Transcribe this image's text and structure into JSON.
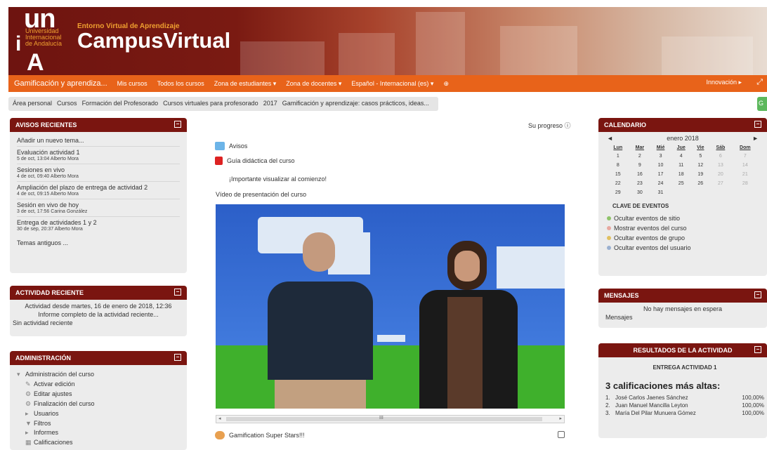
{
  "header": {
    "logo_un": "un",
    "logo_i": "i",
    "logo_sub": [
      "Universidad",
      "Internacional",
      "de Andalucía"
    ],
    "logo_a": "A",
    "entorno": "Entorno Virtual de Aprendizaje",
    "campus": "CampusVirtual"
  },
  "navbar": {
    "brand": "Gamificación y aprendiza...",
    "items": [
      "Mis cursos",
      "Todos los cursos",
      "Zona de estudiantes ▾",
      "Zona de docentes ▾",
      "Español - Internacional (es) ▾",
      "⊕"
    ],
    "user": "Innovación ▸",
    "expand": "⤢"
  },
  "breadcrumb": [
    "Área personal",
    "Cursos",
    "Formación del Profesorado",
    "Cursos virtuales para profesorado",
    "2017",
    "Gamificación y aprendizaje: casos prácticos, ideas..."
  ],
  "green_button": "G",
  "avisos": {
    "title": "AVISOS RECIENTES",
    "add": "Añadir un nuevo tema...",
    "items": [
      {
        "title": "Evaluación actividad 1",
        "meta": "5 de oct, 13:04  Alberto Mora"
      },
      {
        "title": "Sesiones en vivo",
        "meta": "4 de oct, 09:40  Alberto Mora"
      },
      {
        "title": "Ampliación del plazo de entrega de actividad 2",
        "meta": "4 de oct, 09:15  Alberto Mora"
      },
      {
        "title": "Sesión en vivo de hoy",
        "meta": "3 de oct, 17:56  Carina González"
      },
      {
        "title": "Entrega de actividades 1 y 2",
        "meta": "30 de sep, 20:37  Alberto Mora"
      }
    ],
    "old": "Temas antiguos ..."
  },
  "actividad": {
    "title": "ACTIVIDAD RECIENTE",
    "since": "Actividad desde martes, 16 de enero de 2018, 12:36",
    "full": "Informe completo de la actividad reciente...",
    "none": "Sin actividad reciente"
  },
  "admin": {
    "title": "ADMINISTRACIÓN",
    "items": [
      {
        "icon": "▾",
        "label": "Administración del curso"
      },
      {
        "icon": "✎",
        "label": "Activar edición"
      },
      {
        "icon": "⚙",
        "label": "Editar ajustes"
      },
      {
        "icon": "⚙",
        "label": "Finalización del curso"
      },
      {
        "icon": "▸",
        "label": "Usuarios"
      },
      {
        "icon": "▼",
        "label": "Filtros"
      },
      {
        "icon": "▸",
        "label": "Informes"
      },
      {
        "icon": "▦",
        "label": "Calificaciones"
      }
    ]
  },
  "center": {
    "progress": "Su progreso ⓘ",
    "avisos": "Avisos",
    "guia": "Guía didáctica del curso",
    "importante": "¡Importante visualizar al comienzo!",
    "video_title": "Vídeo de presentación del curso",
    "scroll_mid": "III",
    "gamification": "Gamification Super Stars!!!"
  },
  "calendario": {
    "title": "CALENDARIO",
    "month": "enero 2018",
    "prev": "◄",
    "next": "►",
    "days": [
      "Lun",
      "Mar",
      "Mié",
      "Jue",
      "Vie",
      "Sáb",
      "Dom"
    ],
    "weeks": [
      [
        "1",
        "2",
        "3",
        "4",
        "5",
        "6",
        "7"
      ],
      [
        "8",
        "9",
        "10",
        "11",
        "12",
        "13",
        "14"
      ],
      [
        "15",
        "16",
        "17",
        "18",
        "19",
        "20",
        "21"
      ],
      [
        "22",
        "23",
        "24",
        "25",
        "26",
        "27",
        "28"
      ],
      [
        "29",
        "30",
        "31",
        "",
        "",
        "",
        ""
      ]
    ],
    "key_title": "CLAVE DE EVENTOS",
    "keys": [
      {
        "label": "Ocultar eventos de sitio",
        "color": "#8fc36a"
      },
      {
        "label": "Mostrar eventos del curso",
        "color": "#e8a8a0"
      },
      {
        "label": "Ocultar eventos de grupo",
        "color": "#e0c060"
      },
      {
        "label": "Ocultar eventos del usuario",
        "color": "#9ab0d0"
      }
    ]
  },
  "mensajes": {
    "title": "MENSAJES",
    "none": "No hay mensajes en espera",
    "link": "Mensajes"
  },
  "resultados": {
    "title": "RESULTADOS DE LA ACTIVIDAD",
    "activity": "ENTREGA ACTIVIDAD 1",
    "heading": "3 calificaciones más altas:",
    "rows": [
      {
        "n": "1.",
        "name": "José Carlos Jaenes Sánchez",
        "score": "100,00%"
      },
      {
        "n": "2.",
        "name": "Juan Manuel Mancilla Leyton",
        "score": "100,00%"
      },
      {
        "n": "3.",
        "name": "María Del Pilar Munuera Gómez",
        "score": "100,00%"
      }
    ]
  },
  "min_icon": "−"
}
